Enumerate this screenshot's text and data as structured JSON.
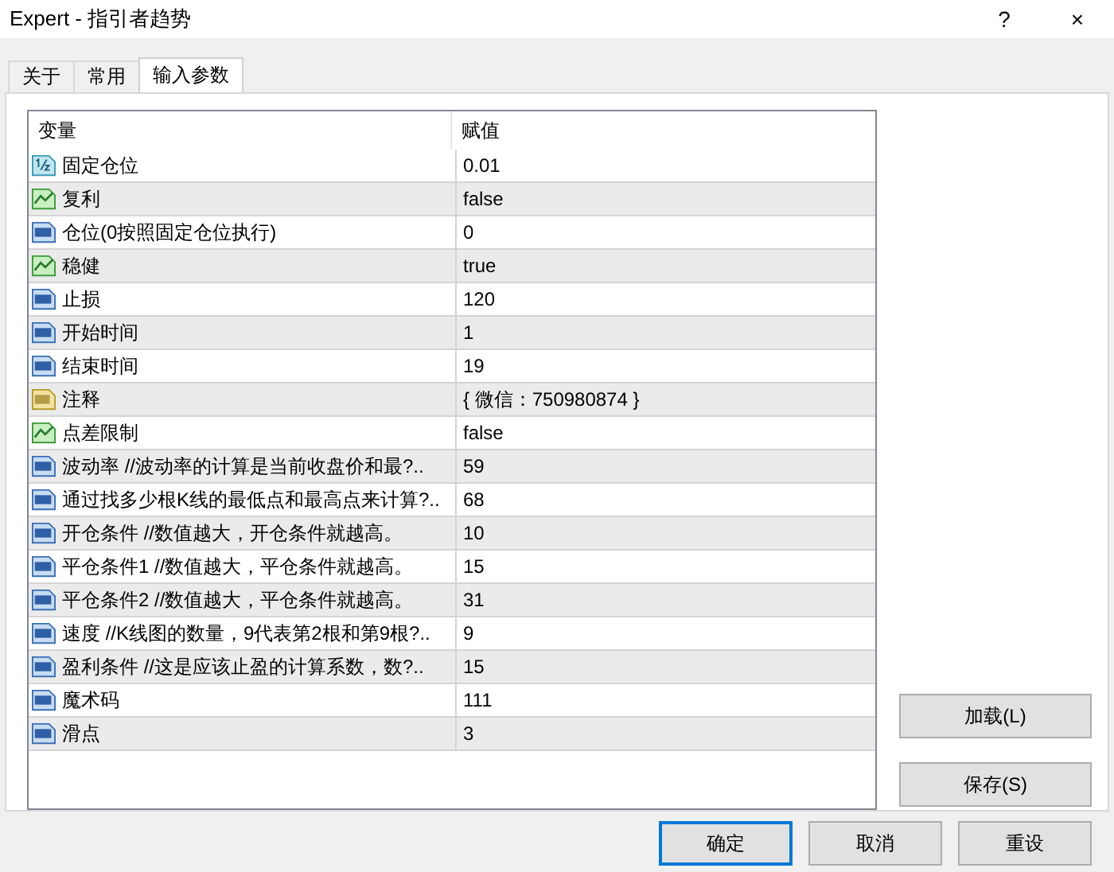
{
  "window": {
    "title": "Expert - 指引者趋势",
    "help": "?",
    "close": "×"
  },
  "tabs": [
    {
      "label": "关于",
      "selected": false
    },
    {
      "label": "常用",
      "selected": false
    },
    {
      "label": "输入参数",
      "selected": true
    }
  ],
  "table": {
    "columns": [
      "变量",
      "赋值"
    ],
    "rows": [
      {
        "kind": "double",
        "name": "固定仓位",
        "value": "0.01"
      },
      {
        "kind": "bool",
        "name": "复利",
        "value": "false"
      },
      {
        "kind": "int",
        "name": "仓位(0按照固定仓位执行)",
        "value": "0"
      },
      {
        "kind": "bool",
        "name": "稳健",
        "value": "true"
      },
      {
        "kind": "int",
        "name": "止损",
        "value": "120"
      },
      {
        "kind": "int",
        "name": "开始时间",
        "value": "1"
      },
      {
        "kind": "int",
        "name": "结束时间",
        "value": "19"
      },
      {
        "kind": "string",
        "name": "注释",
        "value": "{ 微信：750980874 }"
      },
      {
        "kind": "bool",
        "name": "点差限制",
        "value": "false"
      },
      {
        "kind": "int",
        "name": "波动率  //波动率的计算是当前收盘价和最?..",
        "value": "59"
      },
      {
        "kind": "int",
        "name": "通过找多少根K线的最低点和最高点来计算?..",
        "value": "68"
      },
      {
        "kind": "int",
        "name": "开仓条件  //数值越大，开仓条件就越高。",
        "value": "10"
      },
      {
        "kind": "int",
        "name": "平仓条件1  //数值越大，平仓条件就越高。",
        "value": "15"
      },
      {
        "kind": "int",
        "name": "平仓条件2  //数值越大，平仓条件就越高。",
        "value": "31"
      },
      {
        "kind": "int",
        "name": "速度  //K线图的数量，9代表第2根和第9根?..",
        "value": "9"
      },
      {
        "kind": "int",
        "name": "盈利条件  //这是应该止盈的计算系数，数?..",
        "value": "15"
      },
      {
        "kind": "int",
        "name": "魔术码",
        "value": "111"
      },
      {
        "kind": "int",
        "name": "滑点",
        "value": "3"
      }
    ]
  },
  "side_buttons": [
    "加载(L)",
    "保存(S)"
  ],
  "buttons": [
    {
      "label": "确定",
      "selected": true
    },
    {
      "label": "取消",
      "selected": false
    },
    {
      "label": "重设",
      "selected": false
    }
  ]
}
